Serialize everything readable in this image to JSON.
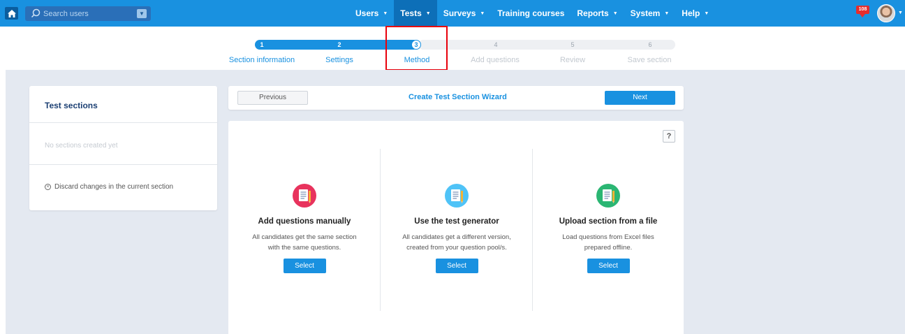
{
  "nav": {
    "search_placeholder": "Search users",
    "menu": [
      {
        "label": "Users",
        "caret": "▼"
      },
      {
        "label": "Tests",
        "caret": "▼"
      },
      {
        "label": "Surveys",
        "caret": "▼"
      },
      {
        "label": "Training courses",
        "caret": ""
      },
      {
        "label": "Reports",
        "caret": "▼"
      },
      {
        "label": "System",
        "caret": "▼"
      },
      {
        "label": "Help",
        "caret": "▼"
      }
    ],
    "active_menu": "Tests",
    "notification_count": "108"
  },
  "wizard": {
    "current_step": 3,
    "steps": [
      {
        "num": "1",
        "label": "Section information"
      },
      {
        "num": "2",
        "label": "Settings"
      },
      {
        "num": "3",
        "label": "Method"
      },
      {
        "num": "4",
        "label": "Add questions"
      },
      {
        "num": "5",
        "label": "Review"
      },
      {
        "num": "6",
        "label": "Save section"
      }
    ]
  },
  "sidebar": {
    "title": "Test sections",
    "empty_note": "No sections created yet",
    "discard_label": "Discard changes in the current section"
  },
  "wizard_bar": {
    "previous_label": "Previous",
    "title": "Create Test Section Wizard",
    "next_label": "Next"
  },
  "help_label": "?",
  "options": [
    {
      "icon": "document-icon",
      "color": "#e8335d",
      "title": "Add questions manually",
      "desc_line1": "All candidates get the same section",
      "desc_line2": "with the same questions.",
      "button": "Select"
    },
    {
      "icon": "document-icon",
      "color": "#4fc3f7",
      "title": "Use the test generator",
      "desc_line1": "All candidates get a different version,",
      "desc_line2": "created from your question pool/s.",
      "button": "Select"
    },
    {
      "icon": "document-icon",
      "color": "#2bb673",
      "title": "Upload section from a file",
      "desc_line1": "Load questions from Excel files",
      "desc_line2": "prepared offline.",
      "button": "Select"
    }
  ]
}
